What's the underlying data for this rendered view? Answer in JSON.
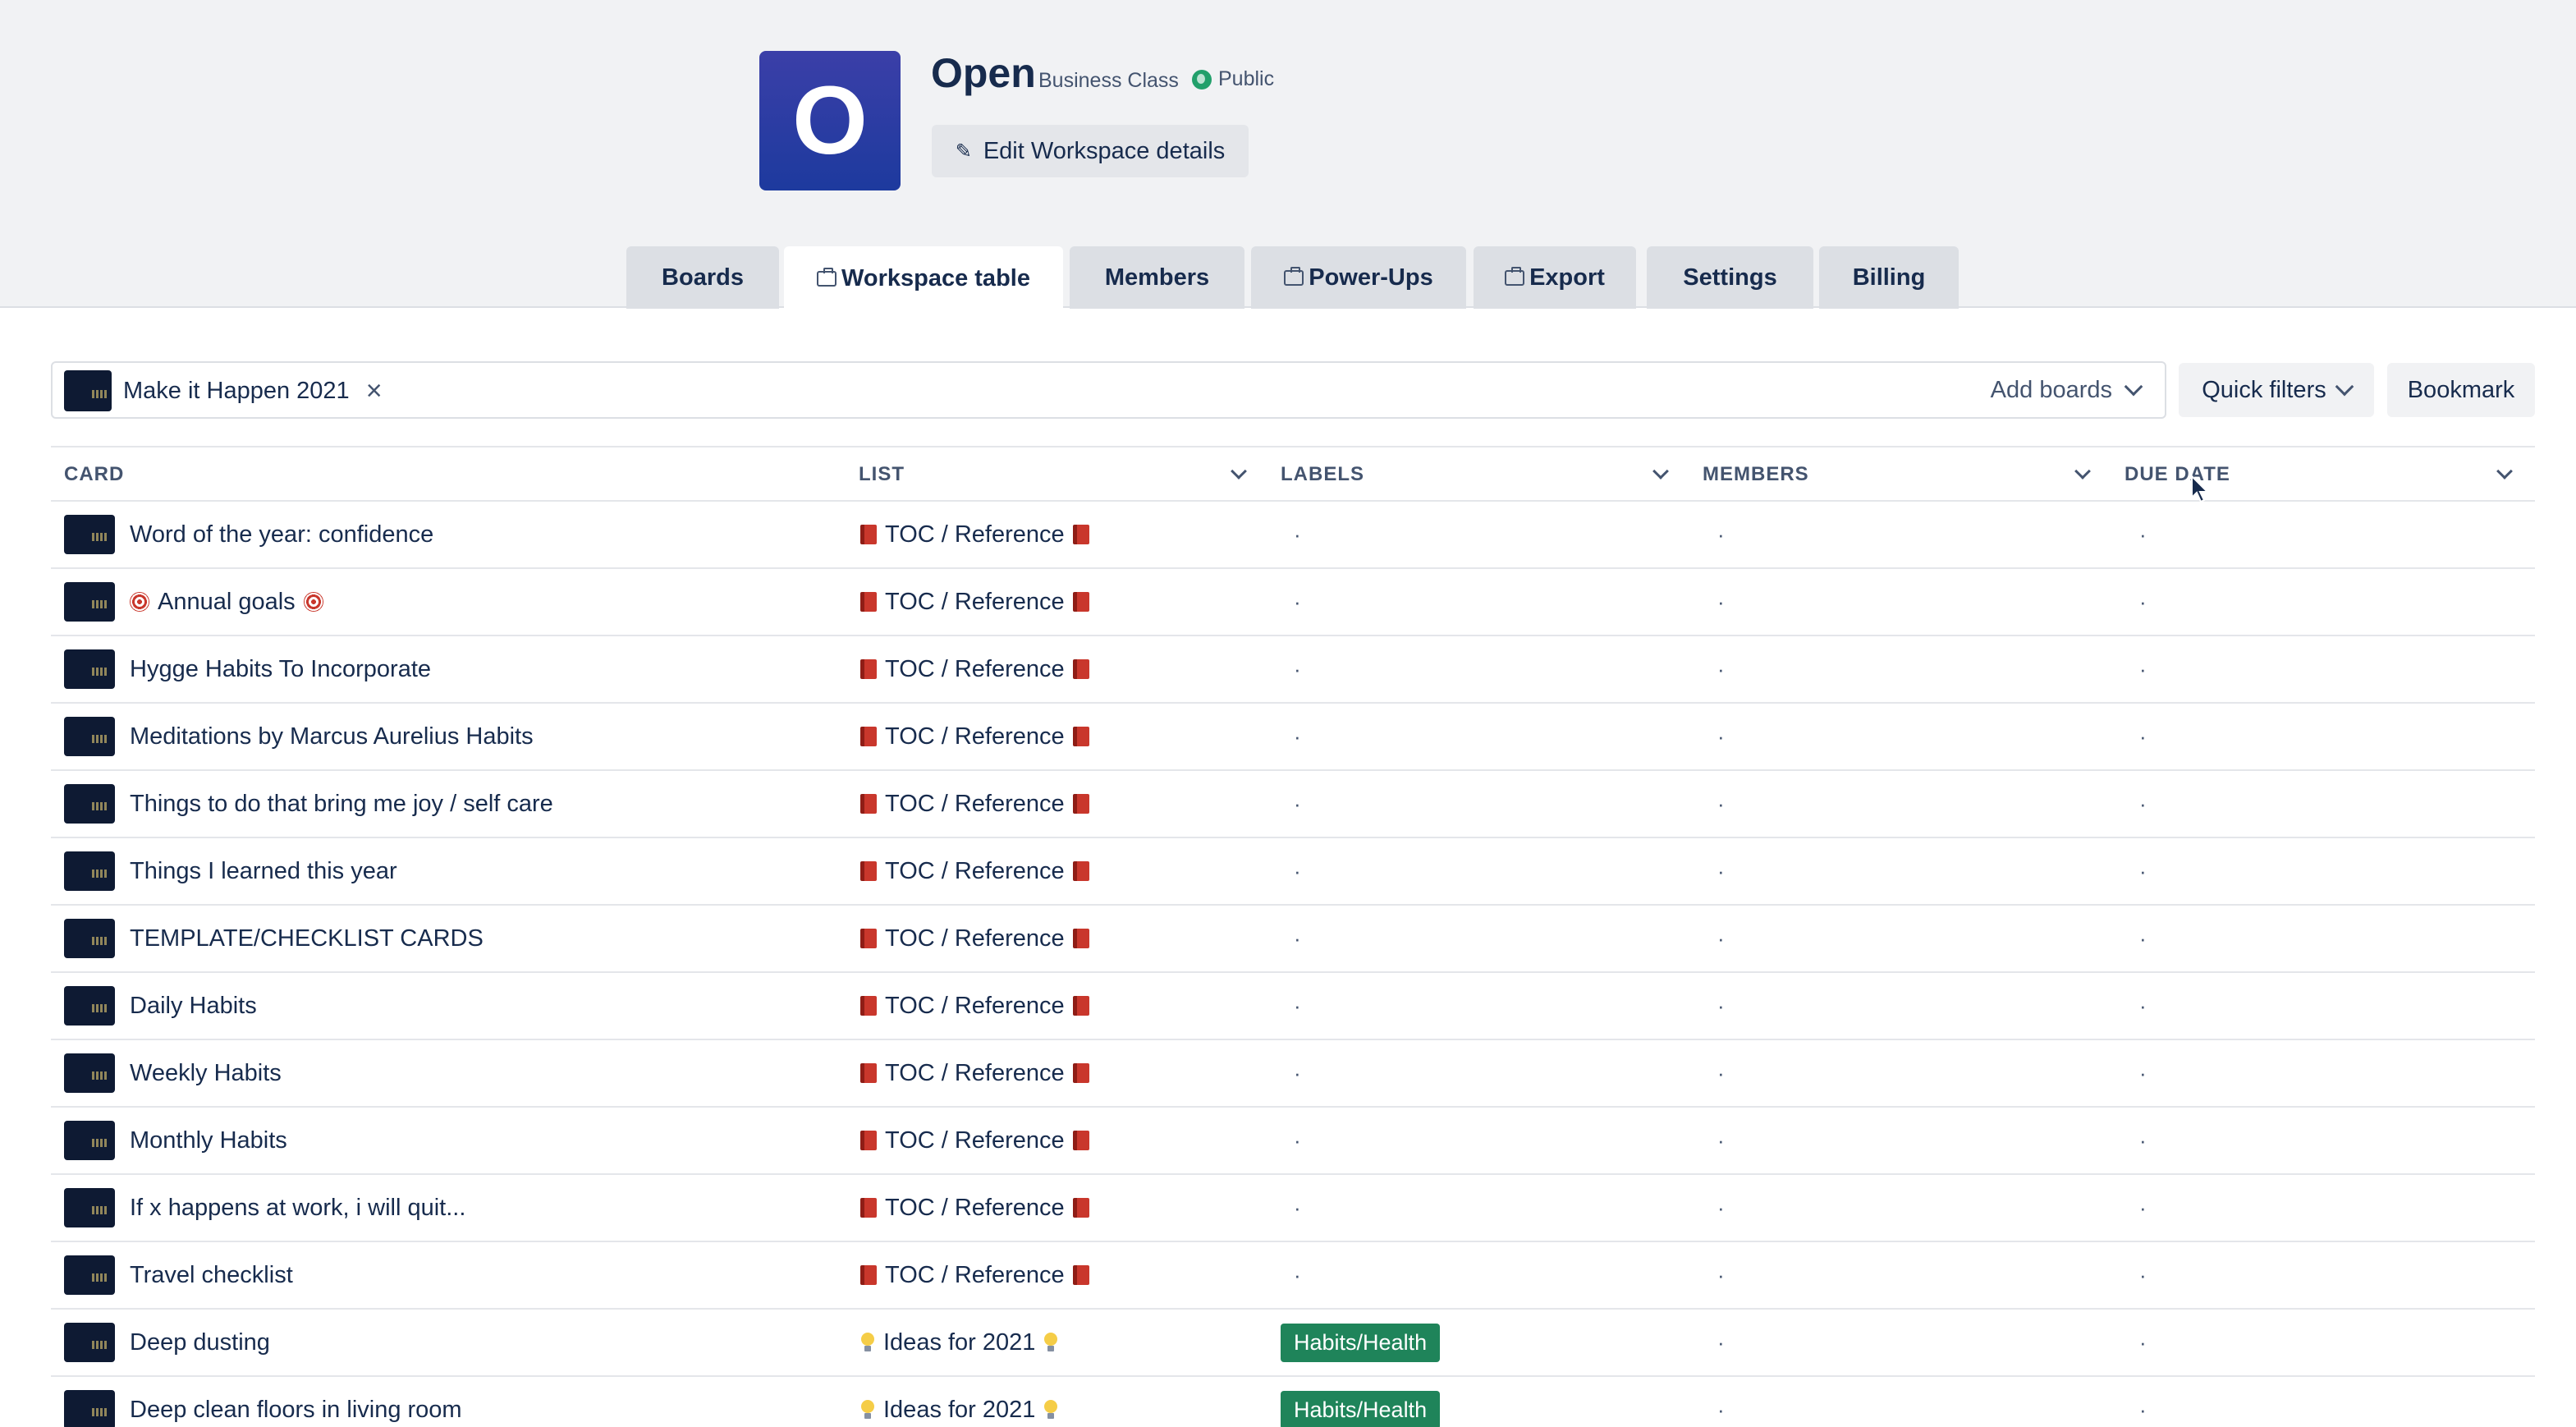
{
  "workspace": {
    "logo_letter": "O",
    "name": "Open",
    "plan": "Business Class",
    "visibility": "Public",
    "edit_label": "Edit Workspace details"
  },
  "tabs": [
    {
      "label": "Boards",
      "active": false,
      "icon": null
    },
    {
      "label": "Workspace table",
      "active": true,
      "icon": "briefcase-icon"
    },
    {
      "label": "Members",
      "active": false,
      "icon": null
    },
    {
      "label": "Power-Ups",
      "active": false,
      "icon": "briefcase-icon"
    },
    {
      "label": "Export",
      "active": false,
      "icon": "briefcase-icon"
    },
    {
      "label": "Settings",
      "active": false,
      "icon": null
    },
    {
      "label": "Billing",
      "active": false,
      "icon": null
    }
  ],
  "filter": {
    "selected_board": "Make it Happen 2021",
    "add_boards_label": "Add boards",
    "quick_filters_label": "Quick filters",
    "bookmark_label": "Bookmark"
  },
  "table": {
    "columns": [
      "CARD",
      "LIST",
      "LABELS",
      "MEMBERS",
      "DUE DATE"
    ],
    "empty_value": "·",
    "rows": [
      {
        "card": "Word of the year: confidence",
        "card_icon": null,
        "list": "TOC / Reference",
        "list_icon": "book-icon",
        "label": null
      },
      {
        "card": "Annual goals",
        "card_icon": "target-icon",
        "list": "TOC / Reference",
        "list_icon": "book-icon",
        "label": null
      },
      {
        "card": "Hygge Habits To Incorporate",
        "card_icon": null,
        "list": "TOC / Reference",
        "list_icon": "book-icon",
        "label": null
      },
      {
        "card": "Meditations by Marcus Aurelius Habits",
        "card_icon": null,
        "list": "TOC / Reference",
        "list_icon": "book-icon",
        "label": null
      },
      {
        "card": "Things to do that bring me joy / self care",
        "card_icon": null,
        "list": "TOC / Reference",
        "list_icon": "book-icon",
        "label": null
      },
      {
        "card": "Things I learned this year",
        "card_icon": null,
        "list": "TOC / Reference",
        "list_icon": "book-icon",
        "label": null
      },
      {
        "card": "TEMPLATE/CHECKLIST CARDS",
        "card_icon": null,
        "list": "TOC / Reference",
        "list_icon": "book-icon",
        "label": null
      },
      {
        "card": "Daily Habits",
        "card_icon": null,
        "list": "TOC / Reference",
        "list_icon": "book-icon",
        "label": null
      },
      {
        "card": "Weekly Habits",
        "card_icon": null,
        "list": "TOC / Reference",
        "list_icon": "book-icon",
        "label": null
      },
      {
        "card": "Monthly Habits",
        "card_icon": null,
        "list": "TOC / Reference",
        "list_icon": "book-icon",
        "label": null
      },
      {
        "card": "If x happens at work, i will quit...",
        "card_icon": null,
        "list": "TOC / Reference",
        "list_icon": "book-icon",
        "label": null
      },
      {
        "card": "Travel checklist",
        "card_icon": null,
        "list": "TOC / Reference",
        "list_icon": "book-icon",
        "label": null
      },
      {
        "card": "Deep dusting",
        "card_icon": null,
        "list": "Ideas for 2021",
        "list_icon": "lightbulb-icon",
        "label": "Habits/Health"
      },
      {
        "card": "Deep clean floors in living room",
        "card_icon": null,
        "list": "Ideas for 2021",
        "list_icon": "lightbulb-icon",
        "label": "Habits/Health"
      }
    ]
  },
  "colors": {
    "header_bg": "#f1f2f4",
    "logo_gradient_top": "#3b3fa8",
    "logo_gradient_bottom": "#1d3a9e",
    "label_green": "#1f845a",
    "public_green": "#22a06b"
  }
}
